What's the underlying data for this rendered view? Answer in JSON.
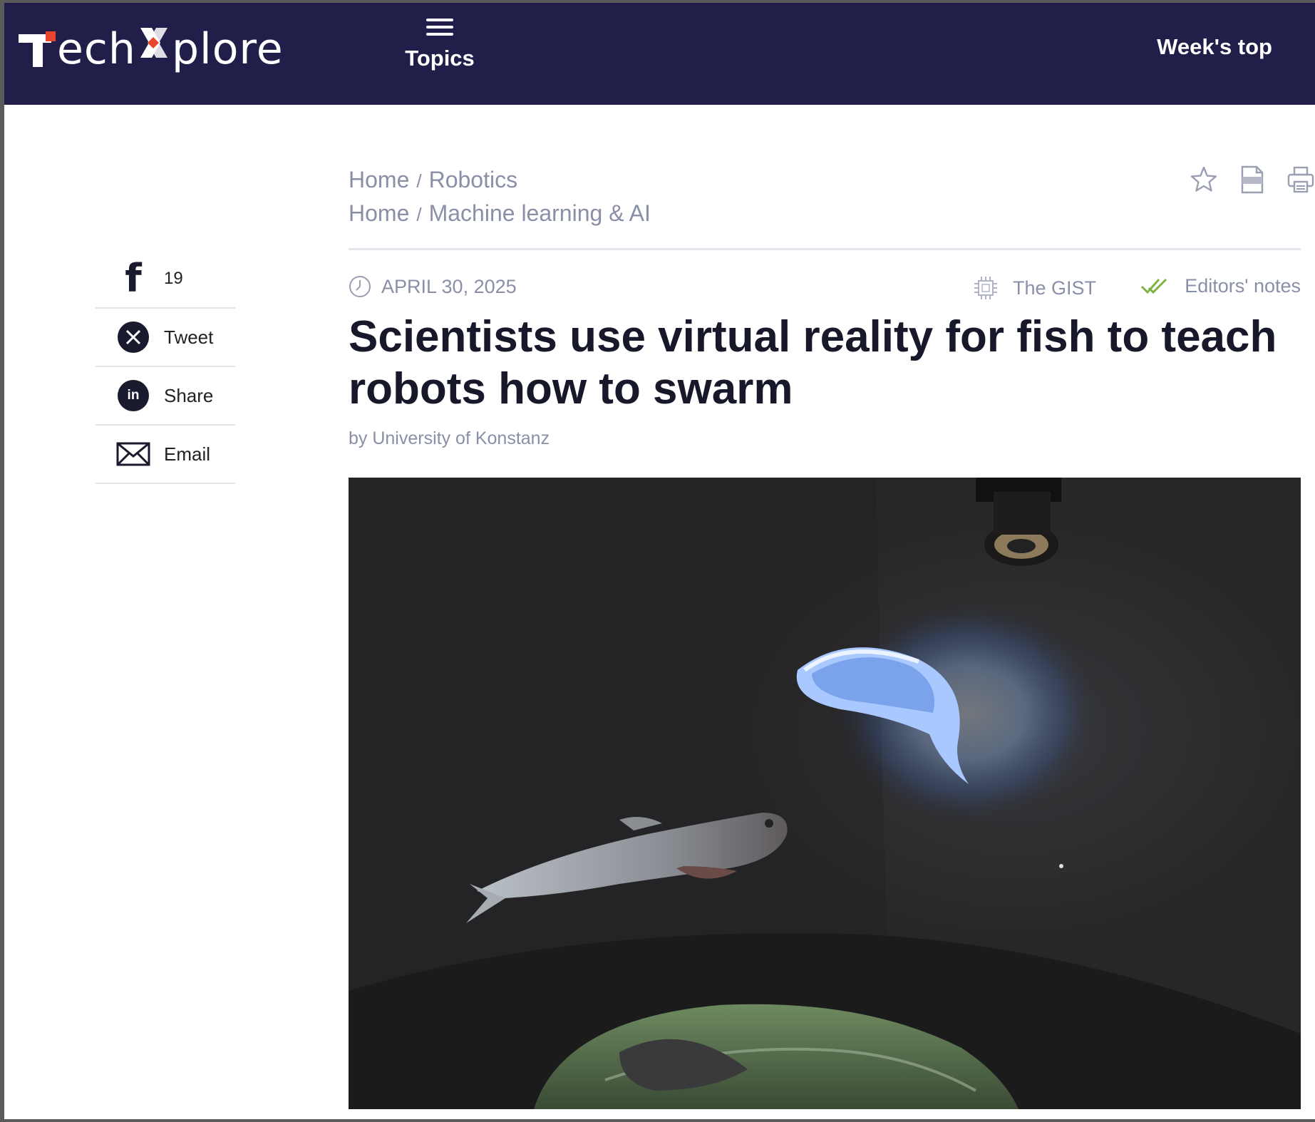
{
  "header": {
    "logo_text": "TechXplore",
    "logo_part1": "ech",
    "logo_part2": "plore",
    "topics_label": "Topics",
    "weeks_top_label": "Week's top"
  },
  "breadcrumbs": [
    {
      "home": "Home",
      "separator": "/",
      "category": "Robotics"
    },
    {
      "home": "Home",
      "separator": "/",
      "category": "Machine learning & AI"
    }
  ],
  "tools": {
    "bookmark_icon": "star-icon",
    "pdf_icon": "pdf-icon",
    "print_icon": "printer-icon"
  },
  "article": {
    "date": "APRIL 30, 2025",
    "gist_label": "The GIST",
    "editors_notes_label": "Editors' notes",
    "title": "Scientists use virtual reality for fish to teach robots how to swarm",
    "byline": "by University of Konstanz",
    "hero_image_description_icon": "fish-vr-photo"
  },
  "share": [
    {
      "icon": "facebook-icon",
      "label": "19"
    },
    {
      "icon": "x-icon",
      "label": "Tweet"
    },
    {
      "icon": "linkedin-icon",
      "label": "Share"
    },
    {
      "icon": "email-icon",
      "label": "Email"
    }
  ],
  "colors": {
    "header_bg": "#221e4a",
    "logo_accent": "#e8452c",
    "muted_text": "#8a8fa8",
    "title_text": "#17182a",
    "check_green": "#7cb342"
  }
}
